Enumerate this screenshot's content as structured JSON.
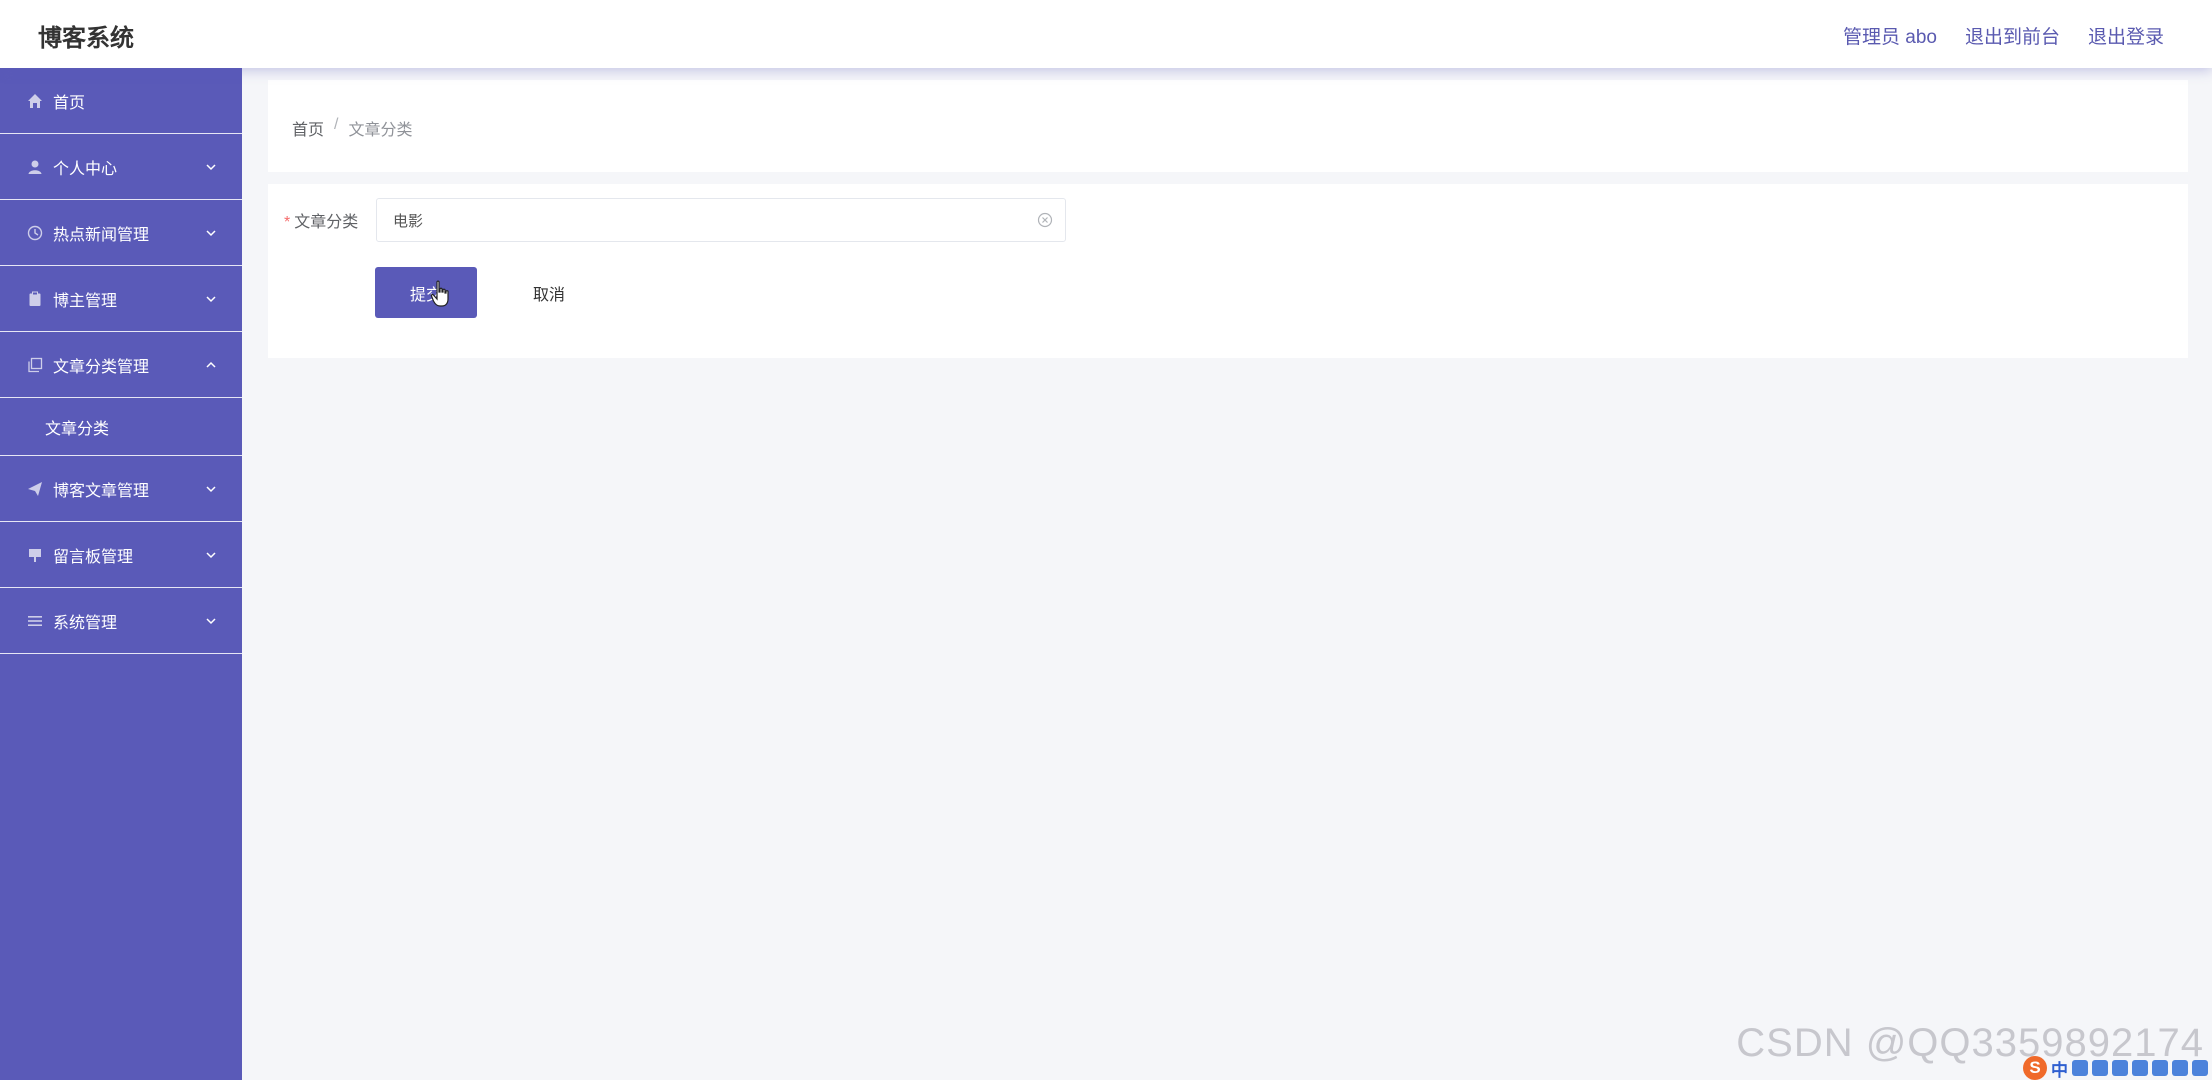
{
  "app": {
    "title": "博客系统"
  },
  "header": {
    "user_label": "管理员 abo",
    "back_to_front": "退出到前台",
    "logout": "退出登录"
  },
  "sidebar": {
    "items": [
      {
        "label": "首页",
        "icon": "home-icon"
      },
      {
        "label": "个人中心",
        "icon": "user-icon"
      },
      {
        "label": "热点新闻管理",
        "icon": "clock-icon"
      },
      {
        "label": "博主管理",
        "icon": "clipboard-icon"
      },
      {
        "label": "文章分类管理",
        "icon": "copy-icon",
        "expanded": true,
        "children": [
          {
            "label": "文章分类"
          }
        ]
      },
      {
        "label": "博客文章管理",
        "icon": "send-icon"
      },
      {
        "label": "留言板管理",
        "icon": "board-icon"
      },
      {
        "label": "系统管理",
        "icon": "menu-list-icon"
      }
    ]
  },
  "breadcrumb": {
    "home": "首页",
    "separator": "/",
    "current": "文章分类"
  },
  "form": {
    "required_mark": "*",
    "field_label": "文章分类",
    "field_value": "电影",
    "submit_label": "提交",
    "cancel_label": "取消"
  },
  "watermark": "CSDN @QQ3359892174",
  "ime": {
    "lang": "中",
    "logo": "S"
  },
  "colors": {
    "primary": "#5a5ab8",
    "background": "#f5f6f9",
    "required": "#f56c6c"
  }
}
